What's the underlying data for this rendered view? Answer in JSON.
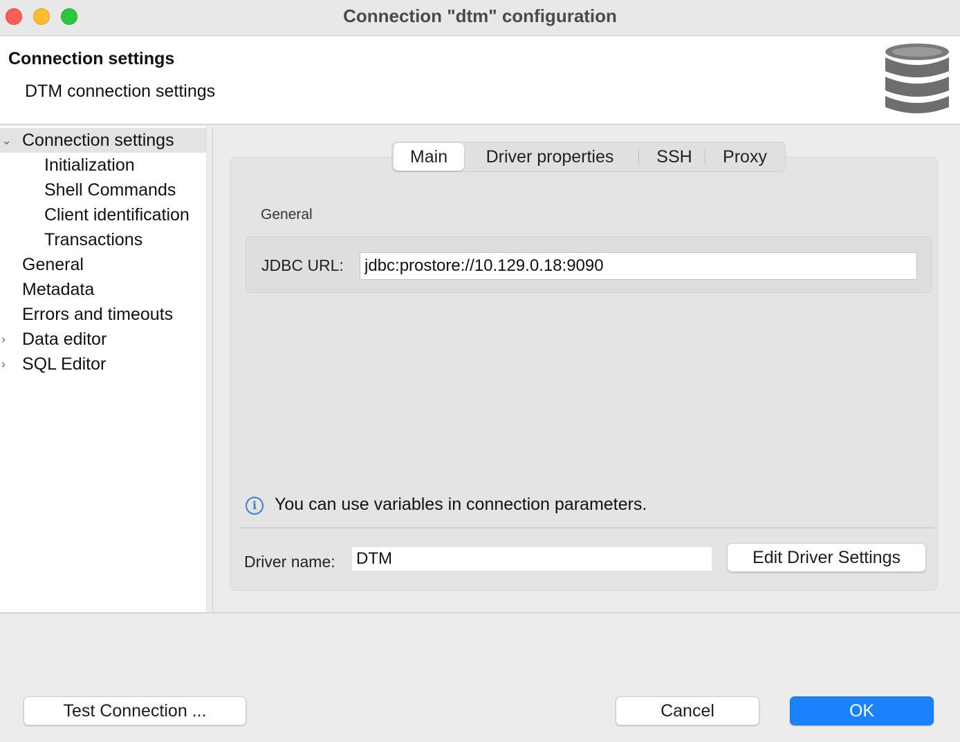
{
  "window": {
    "title": "Connection \"dtm\" configuration"
  },
  "header": {
    "title": "Connection settings",
    "subtitle": "DTM connection settings",
    "icon": "database-icon"
  },
  "sidebar": {
    "items": [
      {
        "label": "Connection settings",
        "expanded": true,
        "selected": true,
        "level": 0,
        "chevron": "chevron-down-icon"
      },
      {
        "label": "Initialization",
        "level": 1
      },
      {
        "label": "Shell Commands",
        "level": 1
      },
      {
        "label": "Client identification",
        "level": 1
      },
      {
        "label": "Transactions",
        "level": 1
      },
      {
        "label": "General",
        "level": 0
      },
      {
        "label": "Metadata",
        "level": 0
      },
      {
        "label": "Errors and timeouts",
        "level": 0
      },
      {
        "label": "Data editor",
        "level": 0,
        "chevron": "chevron-right-icon"
      },
      {
        "label": "SQL Editor",
        "level": 0,
        "chevron": "chevron-right-icon"
      }
    ]
  },
  "tabs": [
    {
      "label": "Main",
      "active": true
    },
    {
      "label": "Driver properties"
    },
    {
      "label": "SSH"
    },
    {
      "label": "Proxy"
    }
  ],
  "general": {
    "group_label": "General",
    "jdbc_label": "JDBC URL:",
    "jdbc_value": "jdbc:prostore://10.129.0.18:9090"
  },
  "info": {
    "icon": "info-icon",
    "text": "You can use variables in connection parameters."
  },
  "driver": {
    "label": "Driver name:",
    "value": "DTM",
    "edit_button": "Edit Driver Settings"
  },
  "footer": {
    "test_button": "Test Connection ...",
    "cancel_button": "Cancel",
    "ok_button": "OK"
  },
  "colors": {
    "primary_button": "#1a82fb",
    "close": "#fe5f57",
    "minimize": "#febc2e",
    "maximize": "#28c840",
    "info_icon": "#3a7fd0"
  }
}
